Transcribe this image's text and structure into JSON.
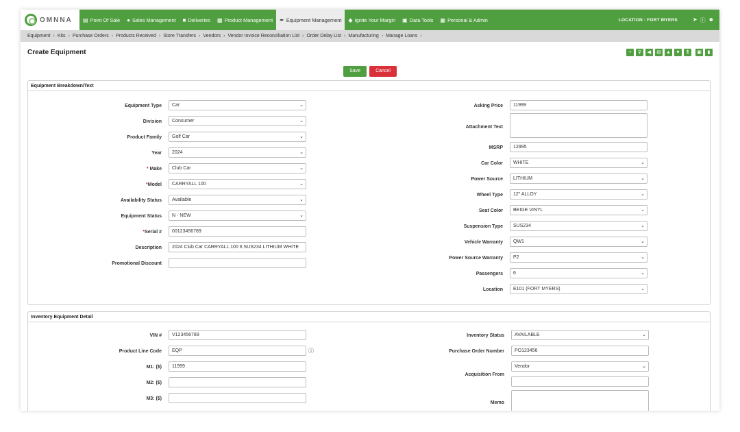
{
  "app": {
    "logo_text": "OMNNA",
    "location": "LOCATION : FORT MYERS"
  },
  "nav": [
    {
      "label": "Point Of Sale",
      "icon": "register-icon"
    },
    {
      "label": "Sales Management",
      "icon": "person-icon"
    },
    {
      "label": "Deliveries",
      "icon": "truck-icon"
    },
    {
      "label": "Product Management",
      "icon": "boxes-icon"
    },
    {
      "label": "Equipment Management",
      "icon": "wrench-icon",
      "active": true
    },
    {
      "label": "Ignite Your Margin",
      "icon": "tag-icon"
    },
    {
      "label": "Data Tools",
      "icon": "database-icon"
    },
    {
      "label": "Personal & Admin",
      "icon": "id-card-icon"
    }
  ],
  "subnav": [
    "Equipment",
    "Kits",
    "Purchase Orders",
    "Products Received",
    "Store Transfers",
    "Vendors",
    "Vendor Invoice Reconciliation List",
    "Order Delay List",
    "Manufacturing",
    "Manage Loans"
  ],
  "page": {
    "title": "Create Equipment",
    "save_label": "Save",
    "cancel_label": "Cancel"
  },
  "panel1": {
    "title": "Equipment Breakdown/Text",
    "left": [
      {
        "label": "Equipment Type",
        "value": "Car",
        "type": "select"
      },
      {
        "label": "Division",
        "value": "Consumer",
        "type": "select"
      },
      {
        "label": "Product Family",
        "value": "Golf Car",
        "type": "select"
      },
      {
        "label": "Year",
        "value": "2024",
        "type": "select"
      },
      {
        "label": "Make",
        "value": "Club Car",
        "type": "select",
        "required": true
      },
      {
        "label": "Model",
        "value": "CARRYALL 100",
        "type": "select",
        "required": true
      },
      {
        "label": "Availability Status",
        "value": "Available",
        "type": "select"
      },
      {
        "label": "Equipment Status",
        "value": "N - NEW",
        "type": "select"
      },
      {
        "label": "Serial #",
        "value": "00123456789",
        "type": "text",
        "required": true
      },
      {
        "label": "Description",
        "value": "2024 Club Car CARRYALL 100 6 SUS234 LITHIUM WHITE",
        "type": "text"
      },
      {
        "label": "Promotional Discount",
        "value": "",
        "type": "text"
      }
    ],
    "right": [
      {
        "label": "Asking Price",
        "value": "11999",
        "type": "text"
      },
      {
        "label": "Attachment Text",
        "value": "",
        "type": "textarea"
      },
      {
        "label": "MSRP",
        "value": "12995",
        "type": "text"
      },
      {
        "label": "Car Color",
        "value": "WHITE",
        "type": "select"
      },
      {
        "label": "Power Source",
        "value": "LITHIUM",
        "type": "select"
      },
      {
        "label": "Wheel Type",
        "value": "12\" ALLOY",
        "type": "select"
      },
      {
        "label": "Seat Color",
        "value": "BEIGE VINYL",
        "type": "select"
      },
      {
        "label": "Suspension Type",
        "value": "SUS234",
        "type": "select"
      },
      {
        "label": "Vehicle Warranty",
        "value": "QW1",
        "type": "select"
      },
      {
        "label": "Power Source Warranty",
        "value": "P2",
        "type": "select"
      },
      {
        "label": "Passengers",
        "value": "6",
        "type": "select"
      },
      {
        "label": "Location",
        "value": "E101 (FORT MYERS)",
        "type": "select"
      }
    ]
  },
  "panel2": {
    "title": "Inventory Equipment Detail",
    "left": [
      {
        "label": "VIN #",
        "value": "V123456789",
        "type": "text"
      },
      {
        "label": "Product Line Code",
        "value": "EQP",
        "type": "text"
      },
      {
        "label": "M1: ($)",
        "value": "11999",
        "type": "text"
      },
      {
        "label": "M2: ($)",
        "value": "",
        "type": "text"
      },
      {
        "label": "M3: ($)",
        "value": "",
        "type": "text"
      }
    ],
    "right": [
      {
        "label": "Inventory Status",
        "value": "AVAILABLE",
        "type": "select"
      },
      {
        "label": "Purchase Order Number",
        "value": "PO123456",
        "type": "text"
      },
      {
        "label": "Acquisition From",
        "value": "Vendor",
        "type": "select"
      },
      {
        "label": "Memo",
        "value": "",
        "type": "textarea"
      }
    ]
  }
}
